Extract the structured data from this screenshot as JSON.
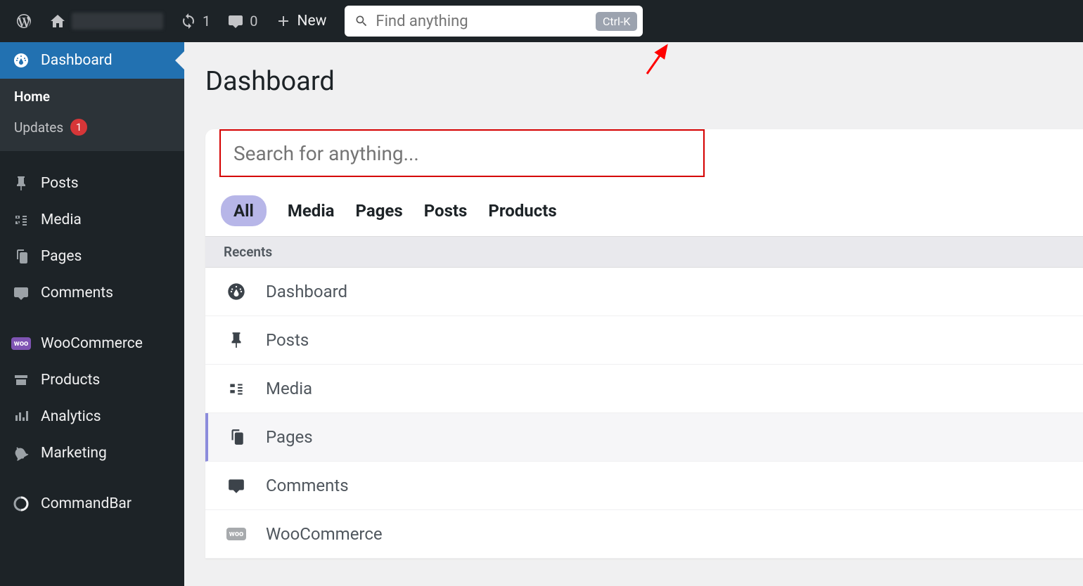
{
  "adminBar": {
    "refreshCount": "1",
    "commentCount": "0",
    "newLabel": "New"
  },
  "topSearch": {
    "placeholder": "Find anything",
    "shortcut": "Ctrl-K"
  },
  "sidebar": {
    "dashboard": "Dashboard",
    "home": "Home",
    "updates": "Updates",
    "updatesCount": "1",
    "posts": "Posts",
    "media": "Media",
    "pages": "Pages",
    "comments": "Comments",
    "woocommerce": "WooCommerce",
    "products": "Products",
    "analytics": "Analytics",
    "marketing": "Marketing",
    "commandbar": "CommandBar"
  },
  "main": {
    "title": "Dashboard",
    "searchPlaceholder": "Search for anything...",
    "tabs": {
      "all": "All",
      "media": "Media",
      "pages": "Pages",
      "posts": "Posts",
      "products": "Products"
    },
    "recentsHeader": "Recents",
    "recents": {
      "dashboard": "Dashboard",
      "posts": "Posts",
      "media": "Media",
      "pages": "Pages",
      "comments": "Comments",
      "woocommerce": "WooCommerce"
    }
  }
}
